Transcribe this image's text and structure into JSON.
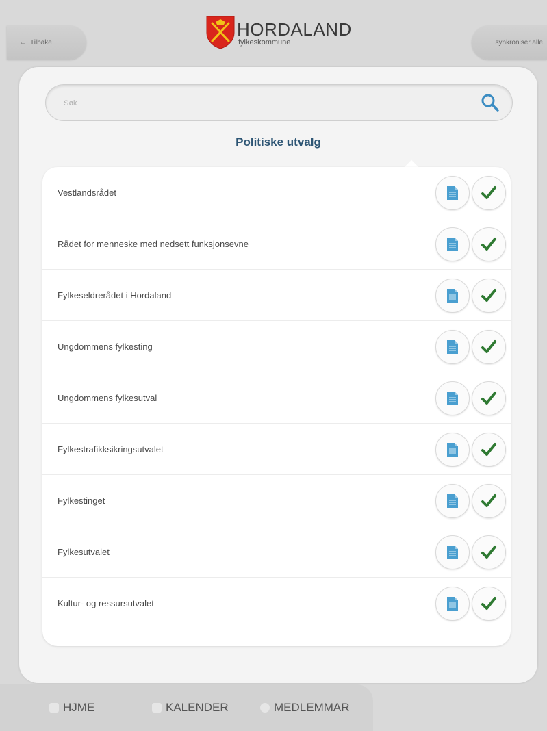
{
  "header": {
    "back_label": "Tilbake",
    "logo_title": "HORDALAND",
    "logo_subtitle": "fylkeskommune",
    "sync_label": "synkroniser alle"
  },
  "search": {
    "placeholder": "Søk"
  },
  "section_title": "Politiske utvalg",
  "list": {
    "items": [
      {
        "label": "Vestlandsrådet"
      },
      {
        "label": "Rådet for menneske med nedsett funksjonsevne"
      },
      {
        "label": "Fylkeseldrerådet i Hordaland"
      },
      {
        "label": "Ungdommens fylkesting"
      },
      {
        "label": "Ungdommens fylkesutval"
      },
      {
        "label": "Fylkestrafikksikringsutvalet"
      },
      {
        "label": "Fylkestinget"
      },
      {
        "label": "Fylkesutvalet"
      },
      {
        "label": "Kultur- og ressursutvalet"
      }
    ]
  },
  "nav": {
    "home_label": "HJME",
    "calendar_label": "KALENDER",
    "members_label": "MEDLEMMAR"
  },
  "colors": {
    "accent": "#2d5574",
    "check": "#2f7a32",
    "doc": "#4a9fd0",
    "shield": "#d9261c"
  }
}
